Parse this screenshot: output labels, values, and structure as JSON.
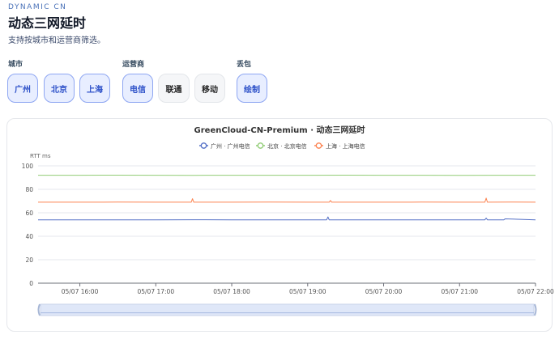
{
  "header": {
    "eyebrow": "DYNAMIC CN",
    "title": "动态三网延时",
    "subtitle": "支持按城市和运营商筛选。"
  },
  "filters": {
    "city": {
      "label": "城市",
      "options": [
        {
          "label": "广州",
          "active": true
        },
        {
          "label": "北京",
          "active": true
        },
        {
          "label": "上海",
          "active": true
        }
      ]
    },
    "carrier": {
      "label": "运营商",
      "options": [
        {
          "label": "电信",
          "active": true
        },
        {
          "label": "联通",
          "active": false
        },
        {
          "label": "移动",
          "active": false
        }
      ]
    },
    "loss": {
      "label": "丢包",
      "options": [
        {
          "label": "绘制",
          "active": true
        }
      ]
    }
  },
  "chart_data": {
    "type": "line",
    "title": "GreenCloud-CN-Premium · 动态三网延时",
    "ylabel": "RTT ms",
    "ylim": [
      0,
      100
    ],
    "yticks": [
      0,
      20,
      40,
      60,
      80,
      100
    ],
    "xlim": [
      "05/07 15:27",
      "05/07 22:00"
    ],
    "xticks": [
      "05/07 16:00",
      "05/07 17:00",
      "05/07 18:00",
      "05/07 19:00",
      "05/07 20:00",
      "05/07 21:00",
      "05/07 22:00"
    ],
    "grid": true,
    "legend_position": "top-center",
    "has_zoom_slider": true,
    "series": [
      {
        "name": "广州 · 广州电信",
        "color": "#5470c6",
        "x": [
          "05/07 15:27",
          "05/07 16:00",
          "05/07 16:30",
          "05/07 17:00",
          "05/07 17:30",
          "05/07 18:00",
          "05/07 18:30",
          "05/07 19:00",
          "05/07 19:15",
          "05/07 19:16",
          "05/07 19:17",
          "05/07 19:30",
          "05/07 20:00",
          "05/07 20:30",
          "05/07 21:00",
          "05/07 21:20",
          "05/07 21:21",
          "05/07 21:22",
          "05/07 21:35",
          "05/07 21:36",
          "05/07 22:00"
        ],
        "values": [
          54,
          54,
          53.9,
          54,
          54.1,
          54,
          53.9,
          54,
          54,
          56.5,
          54,
          54,
          53.9,
          54,
          54,
          54,
          55.5,
          54,
          54,
          54.8,
          54
        ]
      },
      {
        "name": "北京 · 北京电信",
        "color": "#91cc75",
        "x": [
          "05/07 15:27",
          "05/07 16:00",
          "05/07 16:30",
          "05/07 17:00",
          "05/07 17:30",
          "05/07 18:00",
          "05/07 18:30",
          "05/07 19:00",
          "05/07 19:30",
          "05/07 20:00",
          "05/07 20:30",
          "05/07 21:00",
          "05/07 21:30",
          "05/07 22:00"
        ],
        "values": [
          92,
          92,
          92.1,
          92,
          91.9,
          92,
          92,
          92,
          92.1,
          92,
          92,
          91.9,
          92,
          92
        ]
      },
      {
        "name": "上海 · 上海电信",
        "color": "#fc8452",
        "x": [
          "05/07 15:27",
          "05/07 16:00",
          "05/07 16:30",
          "05/07 17:00",
          "05/07 17:28",
          "05/07 17:29",
          "05/07 17:30",
          "05/07 18:00",
          "05/07 18:30",
          "05/07 19:00",
          "05/07 19:17",
          "05/07 19:18",
          "05/07 19:19",
          "05/07 19:30",
          "05/07 20:00",
          "05/07 20:30",
          "05/07 21:00",
          "05/07 21:20",
          "05/07 21:21",
          "05/07 21:22",
          "05/07 21:40",
          "05/07 22:00"
        ],
        "values": [
          69,
          69,
          69.1,
          69,
          69,
          72,
          69,
          69,
          69.1,
          69,
          69,
          70.5,
          69,
          69,
          69,
          69.1,
          69,
          69,
          72.5,
          69,
          69.2,
          69
        ]
      }
    ]
  }
}
